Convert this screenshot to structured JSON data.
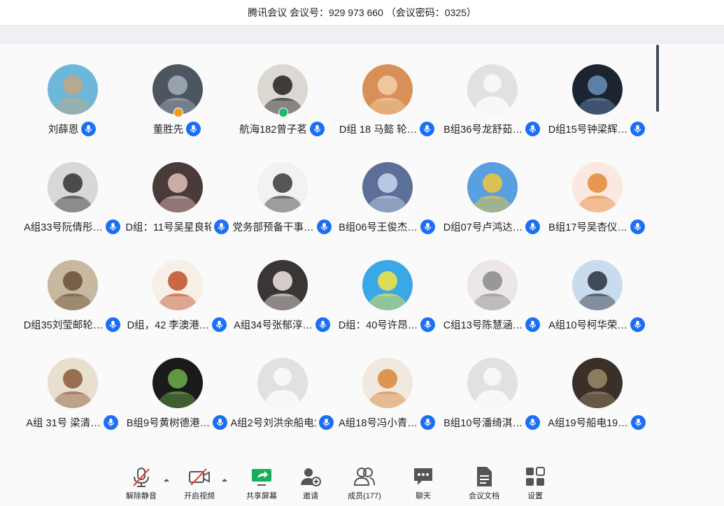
{
  "title": "腾讯会议 会议号：929 973 660 （会议密码：0325）",
  "accent": "#1b6ff5",
  "participants": [
    {
      "name": "刘薛恩",
      "avatar": "stones-photo",
      "bg": "#6cb7da",
      "fg": "#c4a683"
    },
    {
      "name": "董胜先",
      "avatar": "building-photo",
      "bg": "#4d5560",
      "fg": "#a5b0bc",
      "badge": "host-badge-orange"
    },
    {
      "name": "航海182曾子茗",
      "avatar": "girl-hat-photo",
      "bg": "#dcd8d2",
      "fg": "#222222",
      "badge": "cohost-badge-green"
    },
    {
      "name": "D组 18 马懿 轮…",
      "avatar": "anime-boy",
      "bg": "#d89058",
      "fg": "#f4d0a8"
    },
    {
      "name": "B组36号龙舒茹…",
      "avatar": "default-person",
      "bg": "#e1e1e1",
      "fg": "#f7f7f7"
    },
    {
      "name": "D组15号钟梁辉…",
      "avatar": "night-lake-photo",
      "bg": "#1b2430",
      "fg": "#6a8fb8"
    },
    {
      "name": "A组33号阮倩彤…",
      "avatar": "bw-portrait",
      "bg": "#d8d8d8",
      "fg": "#333333"
    },
    {
      "name": "D组：11号吴星良轮…",
      "avatar": "dark-hair-girl",
      "bg": "#4a3a3a",
      "fg": "#e2c2b8"
    },
    {
      "name": "党务部预备干事…",
      "avatar": "cartoon-boy",
      "bg": "#f2f2f2",
      "fg": "#3a3a3a"
    },
    {
      "name": "B组06号王俊杰…",
      "avatar": "dragon-art",
      "bg": "#5b6f98",
      "fg": "#c9d7ee"
    },
    {
      "name": "D组07号卢鸿达…",
      "avatar": "blue-bird",
      "bg": "#5aa0e0",
      "fg": "#f0c83a"
    },
    {
      "name": "B组17号吴杏仪…",
      "avatar": "cartoon-girl-dog",
      "bg": "#fbe8e0",
      "fg": "#e28a3a"
    },
    {
      "name": "D组35刘莹邮轮…",
      "avatar": "otter-photo",
      "bg": "#c8b8a0",
      "fg": "#6a5038"
    },
    {
      "name": "D组，42 李澳港…",
      "avatar": "three-kids",
      "bg": "#f6f0e6",
      "fg": "#c0502a"
    },
    {
      "name": "A组34号张郁淳…",
      "avatar": "girl-mask",
      "bg": "#3a3636",
      "fg": "#f2e8e4"
    },
    {
      "name": "D组：40号许昂…",
      "avatar": "sponge-character",
      "bg": "#3aa8e8",
      "fg": "#f8e640"
    },
    {
      "name": "C组13号陈慧涵…",
      "avatar": "text-note",
      "bg": "#ece6e6",
      "fg": "#8a8a8a"
    },
    {
      "name": "A组10号柯华荣…",
      "avatar": "group-photo",
      "bg": "#c9dcef",
      "fg": "#2a3040"
    },
    {
      "name": "A组 31号 梁清…",
      "avatar": "anime-girl-brown",
      "bg": "#e8dfcf",
      "fg": "#8a5a3a"
    },
    {
      "name": "B组9号黄树德港…",
      "avatar": "joker-figure",
      "bg": "#1a1a1a",
      "fg": "#6fae4a"
    },
    {
      "name": "A组2号刘洪余船电1…",
      "avatar": "default-person",
      "bg": "#e1e1e1",
      "fg": "#f7f7f7"
    },
    {
      "name": "A组18号冯小青…",
      "avatar": "shiba-dog",
      "bg": "#f1e8df",
      "fg": "#d9863b"
    },
    {
      "name": "B组10号潘绮淇…",
      "avatar": "default-person",
      "bg": "#e1e1e1",
      "fg": "#f7f7f7"
    },
    {
      "name": "A组19号船电19…",
      "avatar": "workshop-photo",
      "bg": "#3a3028",
      "fg": "#9a8a6a"
    }
  ],
  "toolbar": [
    {
      "label": "解除静音",
      "icon": "mic-muted-icon",
      "dropdown": true
    },
    {
      "label": "开启视频",
      "icon": "camera-off-icon",
      "dropdown": true
    },
    {
      "label": "共享屏幕",
      "icon": "share-screen-icon",
      "dropdown": false,
      "color": "#1aad5a"
    },
    {
      "label": "邀请",
      "icon": "add-person-icon",
      "dropdown": false
    },
    {
      "label": "成员(177)",
      "icon": "members-icon",
      "dropdown": false
    },
    {
      "label": "聊天",
      "icon": "chat-icon",
      "dropdown": false
    },
    {
      "label": "会议文档",
      "icon": "document-icon",
      "dropdown": false
    },
    {
      "label": "设置",
      "icon": "settings-grid-icon",
      "dropdown": false
    }
  ]
}
